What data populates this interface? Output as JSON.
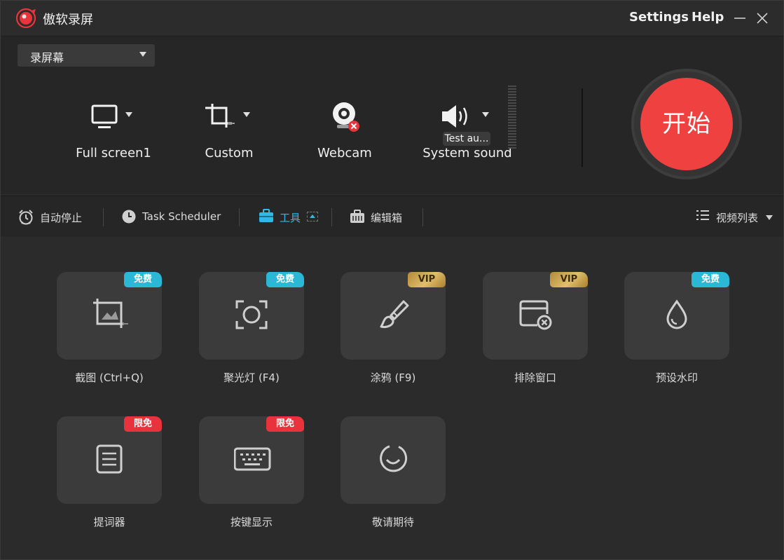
{
  "window": {
    "title": "傲软录屏",
    "settings_label": "Settings",
    "help_label": "Help"
  },
  "recorder": {
    "mode_select": "录屏幕",
    "sources": [
      {
        "label": "Full screen1",
        "icon": "monitor-icon"
      },
      {
        "label": "Custom",
        "icon": "crop-icon"
      },
      {
        "label": "Webcam",
        "icon": "webcam-disabled-icon"
      },
      {
        "label": "System sound",
        "icon": "speaker-icon"
      }
    ],
    "test_audio": "Test au...",
    "start_label": "开始"
  },
  "toolbar": {
    "auto_stop": "自动停止",
    "task_scheduler": "Task Scheduler",
    "tools": "工具",
    "editor": "编辑箱",
    "video_list": "视频列表"
  },
  "tools": [
    {
      "label": "截图 (Ctrl+Q)",
      "badge": "免费",
      "badge_type": "free",
      "icon": "screenshot-icon"
    },
    {
      "label": "聚光灯 (F4)",
      "badge": "免费",
      "badge_type": "free",
      "icon": "spotlight-icon"
    },
    {
      "label": "涂鸦 (F9)",
      "badge": "VIP",
      "badge_type": "vip",
      "icon": "brush-icon"
    },
    {
      "label": "排除窗口",
      "badge": "VIP",
      "badge_type": "vip",
      "icon": "exclude-window-icon"
    },
    {
      "label": "预设水印",
      "badge": "免费",
      "badge_type": "free",
      "icon": "watermark-drop-icon"
    },
    {
      "label": "提词器",
      "badge": "限免",
      "badge_type": "limited",
      "icon": "teleprompter-icon"
    },
    {
      "label": "按键显示",
      "badge": "限免",
      "badge_type": "limited",
      "icon": "keyboard-icon"
    },
    {
      "label": "敬请期待",
      "badge": "",
      "badge_type": "none",
      "icon": "coming-soon-icon"
    }
  ],
  "colors": {
    "accent_red": "#f04141",
    "free_badge": "#2ab8d6",
    "limited_badge": "#e8323c",
    "active_tab": "#31b9e3"
  }
}
